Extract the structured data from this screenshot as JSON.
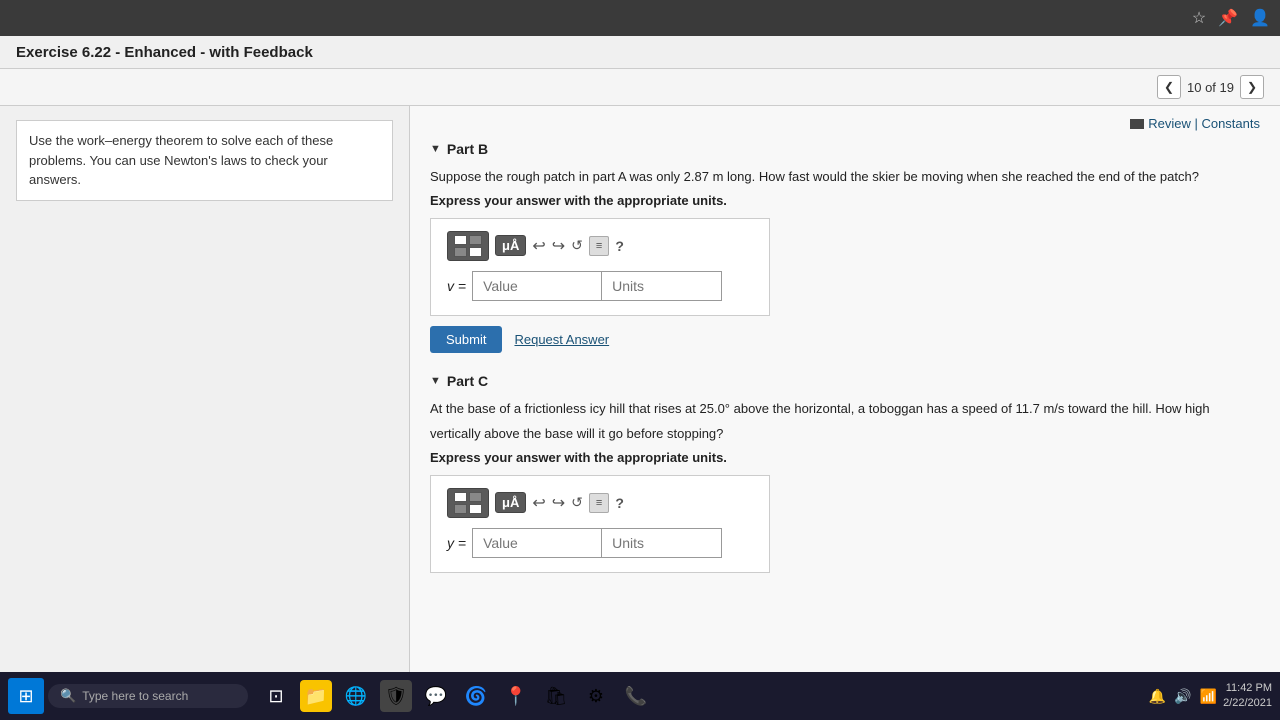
{
  "topbar": {
    "icons": [
      "★",
      "📌",
      "👤"
    ]
  },
  "exercise": {
    "title": "Exercise 6.22 - Enhanced - with Feedback"
  },
  "navigation": {
    "prev_label": "❮",
    "next_label": "❯",
    "page_text": "10 of 19"
  },
  "left_panel": {
    "instruction_text": "Use the work–energy theorem to solve each of these problems. You can use Newton's laws to check your answers."
  },
  "right_panel": {
    "review_label": "Review | Constants",
    "part_b": {
      "header": "Part B",
      "problem_text": "Suppose the rough patch in part A was only 2.87 m long. How fast would the skier be moving when she reached the end of the patch?",
      "express_text": "Express your answer with the appropriate units.",
      "toolbar": {
        "mu_label": "μÅ",
        "undo_label": "↩",
        "redo_label": "↪",
        "refresh_label": "↺",
        "lines_label": "≡",
        "question_label": "?"
      },
      "input": {
        "var_label": "v =",
        "value_placeholder": "Value",
        "units_placeholder": "Units"
      },
      "submit_label": "Submit",
      "request_label": "Request Answer"
    },
    "part_c": {
      "header": "Part C",
      "problem_text_1": "At the base of a frictionless icy hill that rises at 25.0° above the horizontal, a toboggan has a speed of 11.7 m/s toward the hill. How high",
      "problem_text_2": "vertically above the base will it go before stopping?",
      "express_text": "Express your answer with the appropriate units.",
      "toolbar": {
        "mu_label": "μÅ",
        "undo_label": "↩",
        "redo_label": "↪",
        "refresh_label": "↺",
        "lines_label": "≡",
        "question_label": "?"
      },
      "input": {
        "var_label": "y =",
        "value_placeholder": "Value",
        "units_placeholder": "Units"
      }
    }
  },
  "taskbar": {
    "search_placeholder": "Type here to search",
    "time": "11:42 PM",
    "date": "2/22/2021"
  }
}
